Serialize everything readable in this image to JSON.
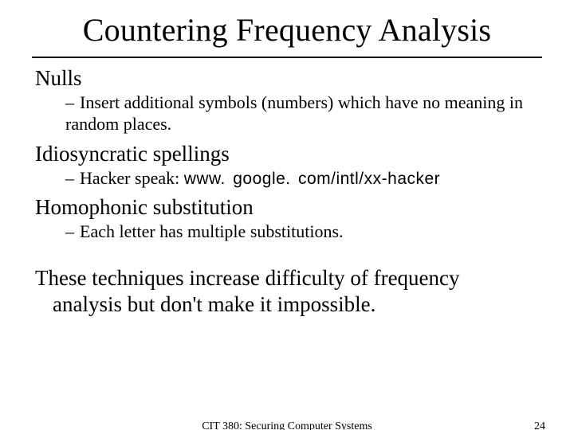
{
  "title": "Countering Frequency Analysis",
  "topics": {
    "nulls": {
      "heading": "Nulls",
      "sub": "Insert additional symbols (numbers) which have no meaning in random places."
    },
    "idio": {
      "heading": "Idiosyncratic spellings",
      "sub_prefix": "Hacker speak: ",
      "sub_link": "www. google. com/intl/xx-hacker"
    },
    "homo": {
      "heading": "Homophonic substitution",
      "sub": "Each letter has multiple substitutions."
    }
  },
  "summary_line1": "These techniques increase difficulty of frequency",
  "summary_line2": "analysis but don't make it impossible.",
  "footer": {
    "course": "CIT 380: Securing Computer Systems",
    "page": "24"
  },
  "glyphs": {
    "dash": "–"
  }
}
